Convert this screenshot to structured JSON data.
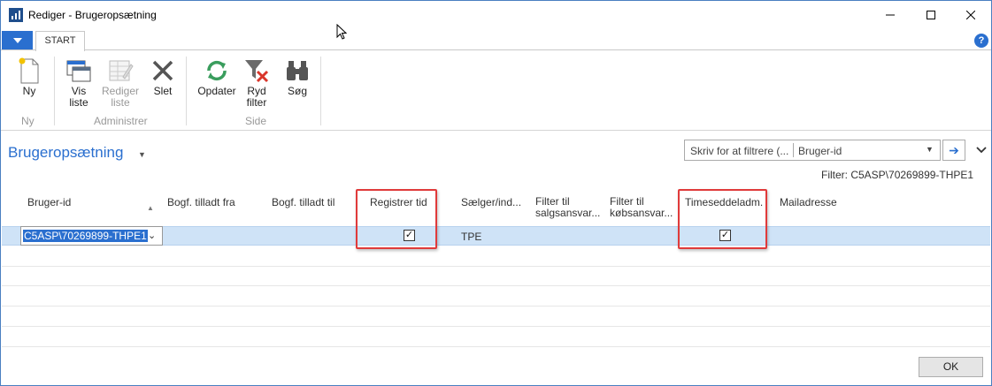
{
  "window": {
    "title": "Rediger - Brugeropsætning"
  },
  "ribbon": {
    "tab_start": "START",
    "help_label": "?",
    "groups": [
      {
        "label": "Ny"
      },
      {
        "label": "Administrer"
      },
      {
        "label": "Side"
      }
    ],
    "buttons": {
      "new": "Ny",
      "view_list_1": "Vis",
      "view_list_2": "liste",
      "edit_list_1": "Rediger",
      "edit_list_2": "liste",
      "delete": "Slet",
      "refresh": "Opdater",
      "clear_filter_1": "Ryd",
      "clear_filter_2": "filter",
      "find": "Søg"
    }
  },
  "page": {
    "title": "Brugeropsætning",
    "filter_placeholder": "Skriv for at filtrere (...",
    "filter_field": "Bruger-id",
    "filter_status": "Filter: C5ASP\\70269899-THPE1"
  },
  "grid": {
    "columns": {
      "user_id": "Bruger-id",
      "allow_from": "Bogf. tilladt fra",
      "allow_to": "Bogf. tilladt til",
      "register_time": "Registrer tid",
      "salesperson_1": "Sælger/ind...",
      "filter_sales_1": "Filter til",
      "filter_sales_2": "salgsansvar...",
      "filter_purch_1": "Filter til",
      "filter_purch_2": "købsansvar...",
      "timesheet_admin": "Timeseddeladm.",
      "email": "Mailadresse"
    },
    "rows": [
      {
        "user_id": "C5ASP\\70269899-THPE1",
        "register_time": true,
        "salesperson": "TPE",
        "timesheet_admin": true
      }
    ]
  },
  "footer": {
    "ok_label": "OK"
  },
  "colors": {
    "accent": "#2a6fcf",
    "selection": "#cfe3f7",
    "highlight_box": "#e03a3a"
  }
}
